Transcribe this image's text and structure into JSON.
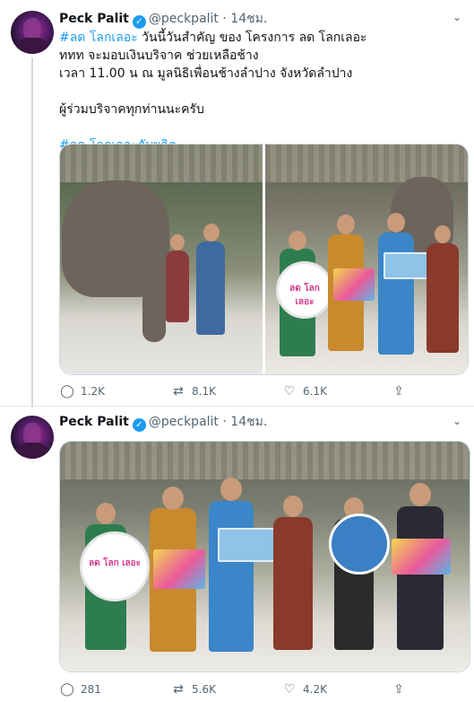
{
  "tweets": [
    {
      "author": {
        "name": "Peck Palit",
        "handle": "@peckpalit",
        "time": "14ชม."
      },
      "lines": [
        {
          "hashtag": "#ลด โลกเลอะ",
          "text": " วันนี้วันสำคัญ ของ  โครงการ ลด โลกเลอะ"
        },
        {
          "hashtag": "",
          "text": "ททท จะมอบเงินบริจาค ช่วยเหลือช้าง"
        },
        {
          "hashtag": "",
          "text": "เวลา 11.00 น ณ มูลนิธิเพื่อนช้างลำปาง จังหวัดลำปาง"
        },
        {
          "hashtag": "",
          "text": "ผู้ร่วมบริจาคทุกท่านนะครับ"
        },
        {
          "hashtag": "#ลด โลกเลอะกับผลิต",
          "text": ""
        }
      ],
      "sign_text": "ลด โลก เลอะ",
      "stats": {
        "replies": "1.2K",
        "retweets": "8.1K",
        "likes": "6.1K"
      }
    },
    {
      "author": {
        "name": "Peck Palit",
        "handle": "@peckpalit",
        "time": "14ชม."
      },
      "sign_text": "ลด โลก เลอะ",
      "stats": {
        "replies": "281",
        "retweets": "5.6K",
        "likes": "4.2K"
      }
    }
  ],
  "icons": {
    "verified": "verified-check-icon",
    "more": "chevron-down-icon",
    "reply": "reply-icon",
    "retweet": "retweet-icon",
    "like": "heart-icon",
    "share": "share-icon"
  },
  "colors": {
    "link": "#1d9bf0",
    "muted": "#536471",
    "border": "#cfd9de"
  }
}
